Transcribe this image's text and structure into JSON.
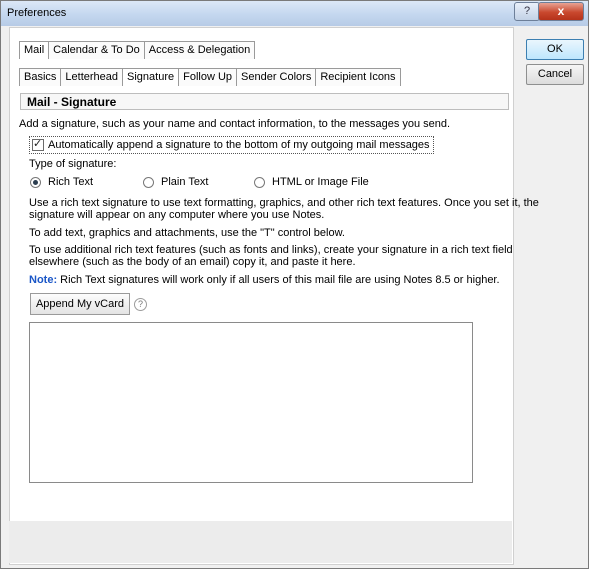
{
  "window": {
    "title": "Preferences",
    "close_glyph": "x",
    "help_glyph": "?"
  },
  "buttons": {
    "ok": "OK",
    "cancel": "Cancel"
  },
  "tabs_top": [
    "Mail",
    "Calendar & To Do",
    "Access & Delegation"
  ],
  "tabs_mail": [
    "Basics",
    "Letterhead",
    "Signature",
    "Follow Up",
    "Sender Colors",
    "Recipient Icons"
  ],
  "section": {
    "title": "Mail - Signature",
    "description": "Add a signature, such as your name and contact information, to the messages you send."
  },
  "auto_append": {
    "label": "Automatically append a signature to the bottom of my outgoing mail messages",
    "checked": true
  },
  "signature_type": {
    "label": "Type of signature:",
    "options": [
      "Rich Text",
      "Plain Text",
      "HTML or Image File"
    ],
    "selected": "Rich Text"
  },
  "help_text": {
    "p1_line1": "Use a rich text signature to use text formatting, graphics, and other rich text features.  Once you set it, the",
    "p1_line2": "signature will appear on any computer where you use Notes.",
    "p2": "To add text, graphics and attachments, use the \"T\" control below.",
    "p3_line1": "To use additional rich text features (such as fonts and links), create your signature in a rich text field",
    "p3_line2": "elsewhere (such as the body of an email) copy it, and paste it here.",
    "note_label": "Note:",
    "note_text": "Rich Text signatures will work only if all users of this mail file are using Notes 8.5 or higher."
  },
  "append_vcard": {
    "label": "Append My vCard",
    "help": "?"
  },
  "colors": {
    "note_label": "#1a56c7",
    "close_button": "#c9482e"
  }
}
